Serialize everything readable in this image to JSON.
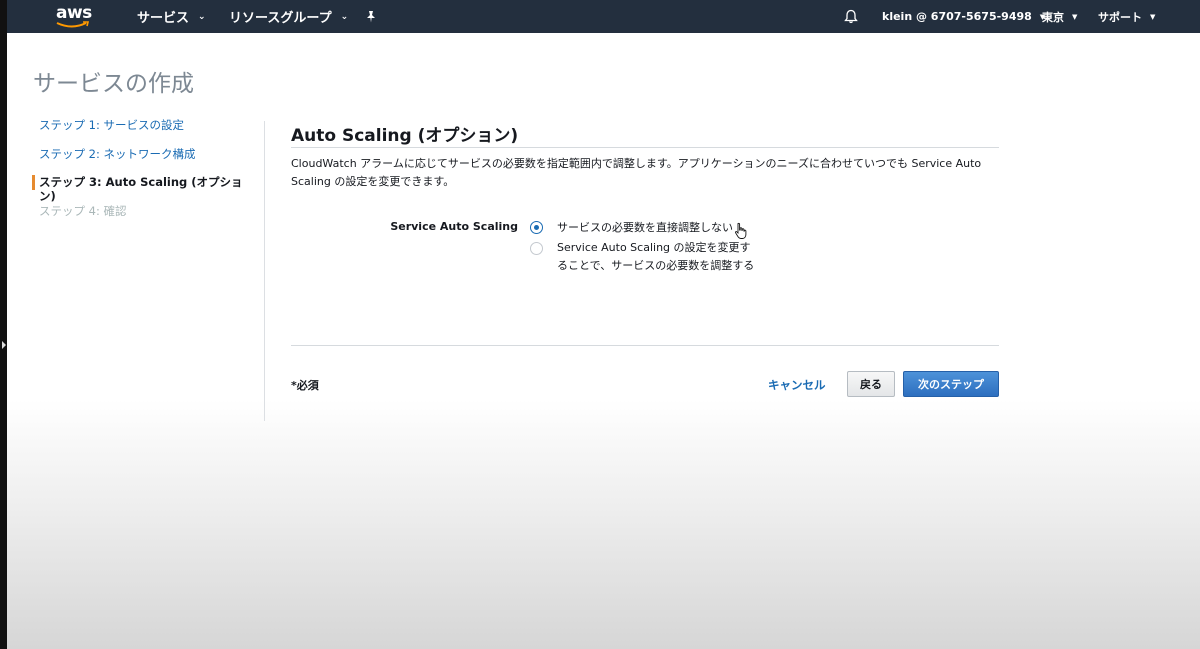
{
  "navbar": {
    "logo_text": "aws",
    "services_label": "サービス",
    "resource_groups_label": "リソースグループ",
    "pin_icon": "pin-icon",
    "bell_icon": "bell-icon",
    "account_label": "klein @ 6707-5675-9498",
    "region_label": "東京",
    "support_label": "サポート",
    "background_color": "#232f3e"
  },
  "page": {
    "title": "サービスの作成"
  },
  "steps": [
    {
      "label": "ステップ 1: サービスの設定",
      "state": "link"
    },
    {
      "label": "ステップ 2: ネットワーク構成",
      "state": "link"
    },
    {
      "label": "ステップ 3: Auto Scaling (オプション)",
      "state": "active"
    },
    {
      "label": "ステップ 4: 確認",
      "state": "disabled"
    }
  ],
  "section": {
    "title": "Auto Scaling (オプション)",
    "description": "CloudWatch アラームに応じてサービスの必要数を指定範囲内で調整します。アプリケーションのニーズに合わせていつでも Service Auto Scaling の設定を変更できます。",
    "field_label": "Service Auto Scaling",
    "options": [
      {
        "label": "サービスの必要数を直接調整しない",
        "selected": true
      },
      {
        "label": "Service Auto Scaling の設定を変更することで、サービスの必要数を調整する",
        "selected": false
      }
    ]
  },
  "footer": {
    "required_label": "*必須",
    "cancel_label": "キャンセル",
    "back_label": "戻る",
    "next_label": "次のステップ"
  },
  "colors": {
    "link": "#1a6bb3",
    "active_step_marker": "#e68b30",
    "primary_button": "#2d6fbf"
  }
}
